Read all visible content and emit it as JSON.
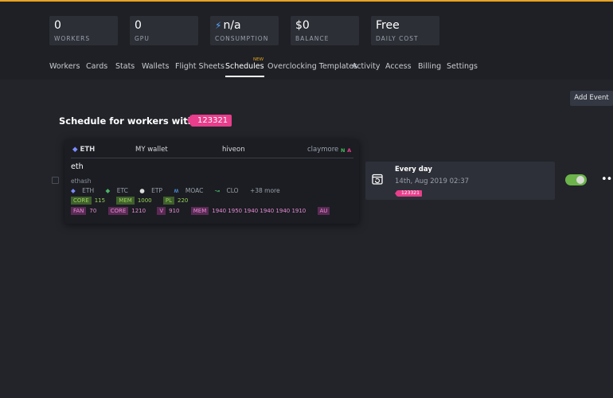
{
  "stats": [
    {
      "value": "0",
      "label": "WORKERS"
    },
    {
      "value": "0",
      "label": "GPU"
    },
    {
      "value": "n/a",
      "label": "CONSUMPTION"
    },
    {
      "value": "$0",
      "label": "BALANCE"
    },
    {
      "value": "Free",
      "label": "DAILY COST"
    }
  ],
  "nav": {
    "items": [
      "Workers",
      "Cards",
      "Stats",
      "Wallets",
      "Flight Sheets",
      "Schedules",
      "Overclocking Templates",
      "Activity",
      "Access",
      "Billing",
      "Settings"
    ],
    "active": "Schedules",
    "new_badge": "NEW"
  },
  "toolbar": {
    "add_event_label": "Add Event"
  },
  "schedule": {
    "title": "Schedule for workers with tags",
    "tag": "123321"
  },
  "flight_sheet": {
    "coin": "ETH",
    "wallet": "MY wallet",
    "pool": "hiveon",
    "miner": "claymore",
    "miner_flags": [
      "N",
      "A"
    ],
    "name": "eth",
    "algo": "ethash",
    "coins": [
      "ETH",
      "ETC",
      "ETP",
      "MOAC",
      "CLO"
    ],
    "more_coins": "+38 more",
    "oc_row1": [
      {
        "label": "CORE",
        "value": "115"
      },
      {
        "label": "MEM",
        "value": "1000"
      },
      {
        "label": "PL",
        "value": "220"
      }
    ],
    "oc_row2": [
      {
        "label": "FAN",
        "value": "70"
      },
      {
        "label": "CORE",
        "value": "1210"
      },
      {
        "label": "V",
        "value": "910"
      },
      {
        "label": "MEM",
        "value": "1940 1950 1940 1940 1940 1910"
      },
      {
        "label": "AU",
        "value": ""
      }
    ]
  },
  "event": {
    "title": "Every day",
    "date": "14th, Aug 2019 02:37",
    "tag": "123321",
    "enabled": true
  },
  "colors": {
    "accent_orange": "#e8a321",
    "tag_pink": "#e83e8c",
    "toggle_green": "#6bb34a",
    "oc_green": "#9bd15a",
    "oc_purple": "#e88bd4"
  }
}
